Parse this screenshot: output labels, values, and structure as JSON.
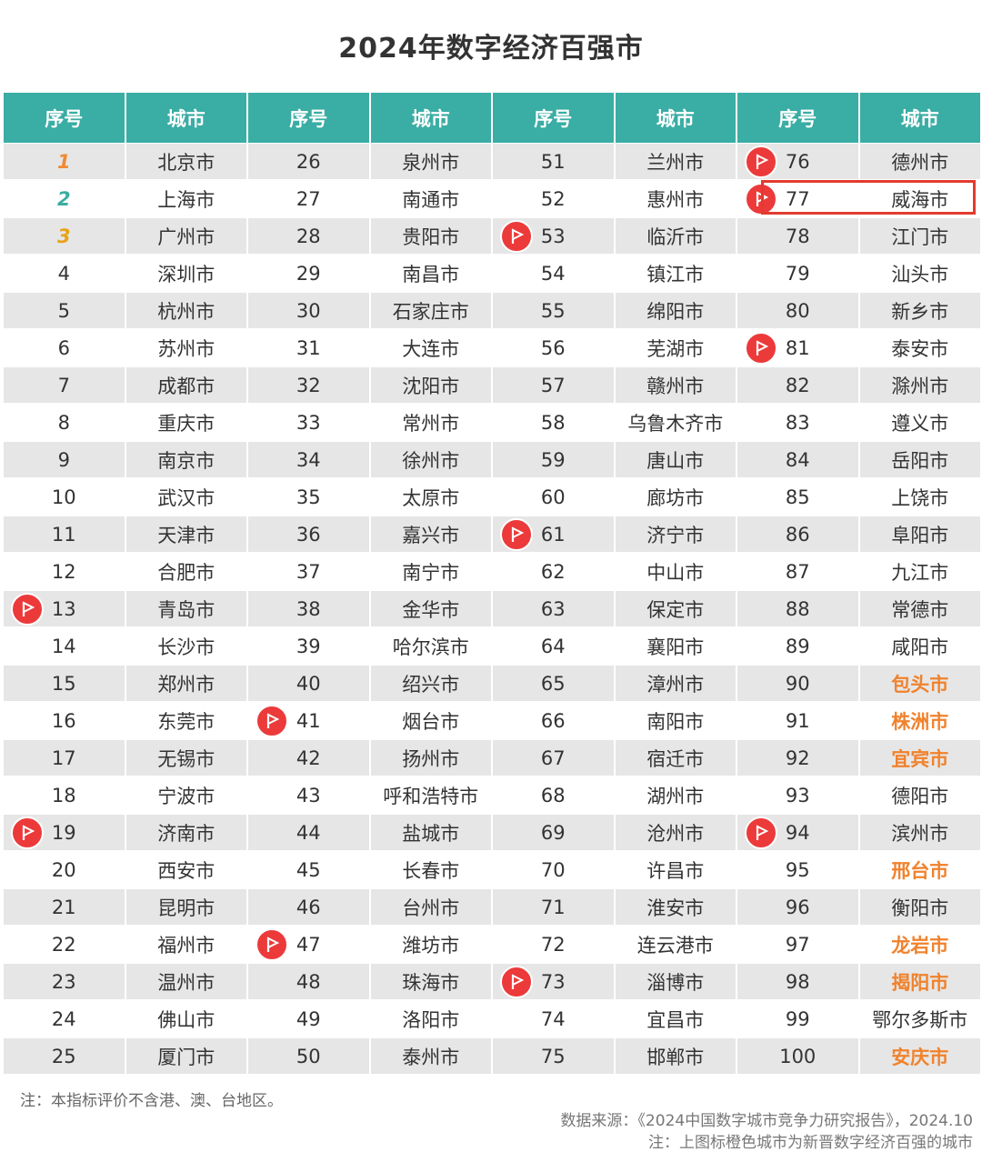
{
  "title": "2024年数字经济百强市",
  "headers": [
    "序号",
    "城市",
    "序号",
    "城市",
    "序号",
    "城市",
    "序号",
    "城市"
  ],
  "rows": [
    [
      "1",
      "北京市",
      "26",
      "泉州市",
      "51",
      "兰州市",
      "76",
      "德州市"
    ],
    [
      "2",
      "上海市",
      "27",
      "南通市",
      "52",
      "惠州市",
      "77",
      "威海市"
    ],
    [
      "3",
      "广州市",
      "28",
      "贵阳市",
      "53",
      "临沂市",
      "78",
      "江门市"
    ],
    [
      "4",
      "深圳市",
      "29",
      "南昌市",
      "54",
      "镇江市",
      "79",
      "汕头市"
    ],
    [
      "5",
      "杭州市",
      "30",
      "石家庄市",
      "55",
      "绵阳市",
      "80",
      "新乡市"
    ],
    [
      "6",
      "苏州市",
      "31",
      "大连市",
      "56",
      "芜湖市",
      "81",
      "泰安市"
    ],
    [
      "7",
      "成都市",
      "32",
      "沈阳市",
      "57",
      "赣州市",
      "82",
      "滁州市"
    ],
    [
      "8",
      "重庆市",
      "33",
      "常州市",
      "58",
      "乌鲁木齐市",
      "83",
      "遵义市"
    ],
    [
      "9",
      "南京市",
      "34",
      "徐州市",
      "59",
      "唐山市",
      "84",
      "岳阳市"
    ],
    [
      "10",
      "武汉市",
      "35",
      "太原市",
      "60",
      "廊坊市",
      "85",
      "上饶市"
    ],
    [
      "11",
      "天津市",
      "36",
      "嘉兴市",
      "61",
      "济宁市",
      "86",
      "阜阳市"
    ],
    [
      "12",
      "合肥市",
      "37",
      "南宁市",
      "62",
      "中山市",
      "87",
      "九江市"
    ],
    [
      "13",
      "青岛市",
      "38",
      "金华市",
      "63",
      "保定市",
      "88",
      "常德市"
    ],
    [
      "14",
      "长沙市",
      "39",
      "哈尔滨市",
      "64",
      "襄阳市",
      "89",
      "咸阳市"
    ],
    [
      "15",
      "郑州市",
      "40",
      "绍兴市",
      "65",
      "漳州市",
      "90",
      "包头市"
    ],
    [
      "16",
      "东莞市",
      "41",
      "烟台市",
      "66",
      "南阳市",
      "91",
      "株洲市"
    ],
    [
      "17",
      "无锡市",
      "42",
      "扬州市",
      "67",
      "宿迁市",
      "92",
      "宜宾市"
    ],
    [
      "18",
      "宁波市",
      "43",
      "呼和浩特市",
      "68",
      "湖州市",
      "93",
      "德阳市"
    ],
    [
      "19",
      "济南市",
      "44",
      "盐城市",
      "69",
      "沧州市",
      "94",
      "滨州市"
    ],
    [
      "20",
      "西安市",
      "45",
      "长春市",
      "70",
      "许昌市",
      "95",
      "邢台市"
    ],
    [
      "21",
      "昆明市",
      "46",
      "台州市",
      "71",
      "淮安市",
      "96",
      "衡阳市"
    ],
    [
      "22",
      "福州市",
      "47",
      "潍坊市",
      "72",
      "连云港市",
      "97",
      "龙岩市"
    ],
    [
      "23",
      "温州市",
      "48",
      "珠海市",
      "73",
      "淄博市",
      "98",
      "揭阳市"
    ],
    [
      "24",
      "佛山市",
      "49",
      "洛阳市",
      "74",
      "宜昌市",
      "99",
      "鄂尔多斯市"
    ],
    [
      "25",
      "厦门市",
      "50",
      "泰州市",
      "75",
      "邯郸市",
      "100",
      "安庆市"
    ]
  ],
  "top_classes": {
    "1": "top1",
    "2": "top2",
    "3": "top3"
  },
  "new_cities": [
    "包头市",
    "株洲市",
    "宜宾市",
    "邢台市",
    "龙岩市",
    "揭阳市",
    "安庆市"
  ],
  "flagged_ranks": [
    "13",
    "19",
    "41",
    "47",
    "53",
    "61",
    "73",
    "76",
    "77",
    "81",
    "94"
  ],
  "highlighted_rank": "77",
  "notes": {
    "note1": "注：本指标评价不含港、澳、台地区。",
    "source": "数据来源：《2024中国数字城市竞争力研究报告》，2024.10",
    "note2": "注：上图标橙色城市为新晋数字经济百强的城市"
  },
  "colors": {
    "header_bg": "#3aada4",
    "stripe": "#e6e6e6",
    "new_city": "#f0822d",
    "flag": "#ec3a3a",
    "highlight_box": "#e23b2e"
  },
  "icons": {
    "flag": "flag-pin-icon"
  }
}
